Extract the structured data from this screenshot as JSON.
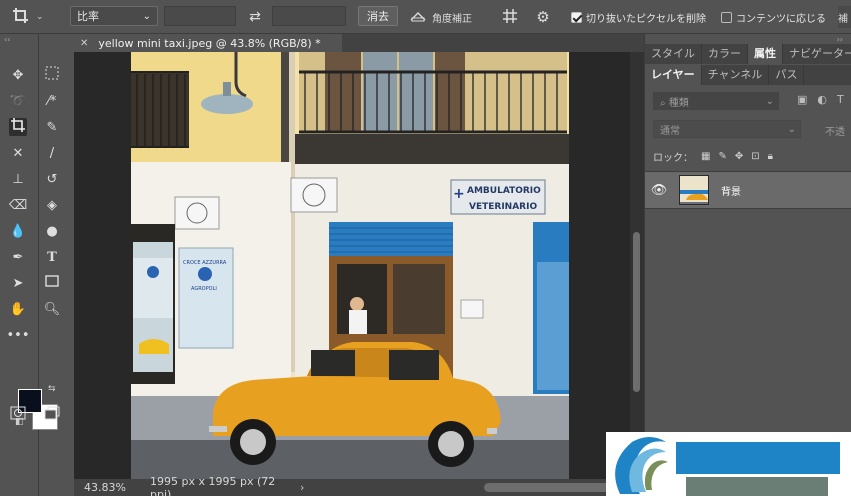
{
  "options_bar": {
    "ratio_value": "比率",
    "clear_label": "消去",
    "straighten_label": "角度補正",
    "delete_pixels_label": "切り抜いたピクセルを削除",
    "delete_pixels_checked": true,
    "content_aware_label": "コンテンツに応じる",
    "content_aware_checked": false,
    "truncated_label": "補"
  },
  "document": {
    "tab_title": "yellow mini taxi.jpeg @ 43.8% (RGB/8) *",
    "zoom": "43.83%",
    "size_info": "1995 px x 1995 px (72 ppi)"
  },
  "colors": {
    "foreground": "#0a0f1e",
    "background": "#ffffff",
    "car": "#e8a020",
    "shutter": "#2a7cc0"
  },
  "panel": {
    "top_tabs": [
      "スタイル",
      "カラー",
      "属性",
      "ナビゲーター"
    ],
    "top_active": "属性",
    "layer_tabs": [
      "レイヤー",
      "チャンネル",
      "パス"
    ],
    "layer_active": "レイヤー",
    "filter_placeholder": "種類",
    "blend_mode": "通常",
    "opacity_label": "不透",
    "lock_label": "ロック：",
    "layers": [
      {
        "name": "背景",
        "visible": true
      }
    ]
  },
  "photo": {
    "sign_top": "AMBULATORIO",
    "sign_bottom": "VETERINARIO",
    "poster_top": "CROCE AZZURRA",
    "poster_bottom": "AGROPOLI"
  },
  "tools": [
    "move-icon",
    "marquee-icon",
    "lasso-icon",
    "magic-wand-icon",
    "crop-icon",
    "eyedropper-icon",
    "healing-icon",
    "brush-icon",
    "stamp-icon",
    "history-brush-icon",
    "eraser-icon",
    "bucket-icon",
    "blur-icon",
    "dodge-icon",
    "pen-icon",
    "type-icon",
    "path-select-icon",
    "rectangle-icon",
    "hand-icon",
    "zoom-icon",
    "more-icon"
  ]
}
